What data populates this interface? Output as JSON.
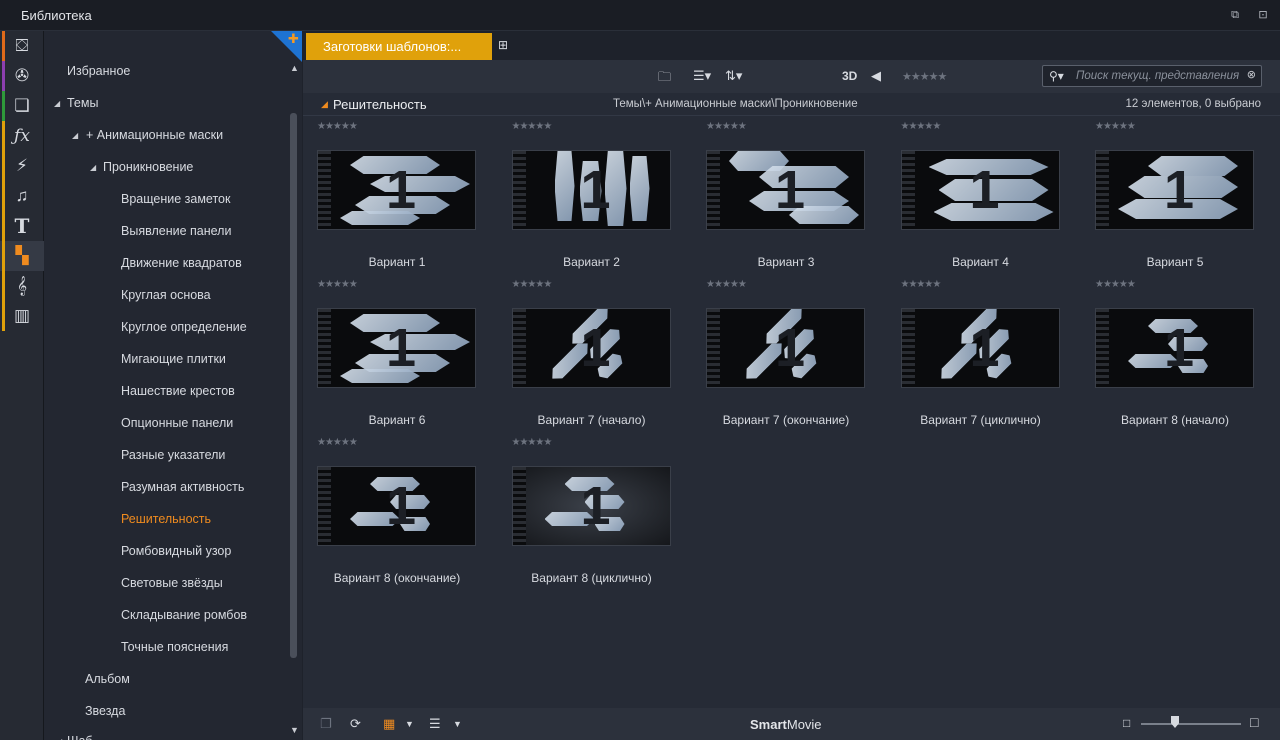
{
  "window": {
    "title": "Библиотека"
  },
  "sidebar_icons": [
    {
      "icon": "projects-icon",
      "stripe": "#e06a1a"
    },
    {
      "icon": "film-reel-icon",
      "stripe": "#8d3fb0"
    },
    {
      "icon": "media-stack-icon",
      "stripe": "#2e9a3a"
    },
    {
      "icon": "effects-icon",
      "stripe": "#e0a10b"
    },
    {
      "icon": "lightning-icon",
      "stripe": "#e0a10b"
    },
    {
      "icon": "music-note-icon",
      "stripe": "#e0a10b"
    },
    {
      "icon": "title-icon",
      "stripe": "#e0a10b"
    },
    {
      "icon": "montage-icon",
      "stripe": "#e0a10b"
    },
    {
      "icon": "treble-clef-icon",
      "stripe": "#e0a10b"
    },
    {
      "icon": "piano-icon",
      "stripe": "#e0a10b"
    }
  ],
  "tree": {
    "items": [
      {
        "label": "Избранное"
      },
      {
        "label": "Темы"
      },
      {
        "label": "+ Анимационные маски"
      },
      {
        "label": "Проникновение"
      },
      {
        "label": "Вращение заметок"
      },
      {
        "label": "Выявление панели"
      },
      {
        "label": "Движение квадратов"
      },
      {
        "label": "Круглая основа"
      },
      {
        "label": "Круглое определение"
      },
      {
        "label": "Мигающие плитки"
      },
      {
        "label": "Нашествие крестов"
      },
      {
        "label": "Опционные панели"
      },
      {
        "label": "Разные указатели"
      },
      {
        "label": "Разумная активность"
      },
      {
        "label": "Решительность",
        "selected": true
      },
      {
        "label": "Ромбовидный узор"
      },
      {
        "label": "Световые звёзды"
      },
      {
        "label": "Складывание ромбов"
      },
      {
        "label": "Точные пояснения"
      },
      {
        "label": "Альбом"
      },
      {
        "label": "Звезда"
      },
      {
        "label": "Шаб..."
      }
    ]
  },
  "tab": {
    "label": "Заготовки шаблонов:..."
  },
  "toolbar": {
    "three_d": "3D",
    "rating": "★★★★★",
    "search_placeholder": "Поиск текущ. представления"
  },
  "pathbar": {
    "title": "Решительность",
    "path": "Темы\\+ Анимационные маски\\Проникновение",
    "count": "12 элементов, 0 выбрано"
  },
  "items": [
    {
      "label": "Вариант 1",
      "stars": "★★★★★",
      "num": "1"
    },
    {
      "label": "Вариант 2",
      "stars": "★★★★★",
      "num": "1"
    },
    {
      "label": "Вариант 3",
      "stars": "★★★★★",
      "num": "1"
    },
    {
      "label": "Вариант 4",
      "stars": "★★★★★",
      "num": "1"
    },
    {
      "label": "Вариант 5",
      "stars": "★★★★★",
      "num": "1"
    },
    {
      "label": "Вариант 6",
      "stars": "★★★★★",
      "num": "1"
    },
    {
      "label": "Вариант 7 (начало)",
      "stars": "★★★★★",
      "num": "1"
    },
    {
      "label": "Вариант 7 (окончание)",
      "stars": "★★★★★",
      "num": "1"
    },
    {
      "label": "Вариант 7 (циклично)",
      "stars": "★★★★★",
      "num": "1"
    },
    {
      "label": "Вариант 8 (начало)",
      "stars": "★★★★★",
      "num": "1"
    },
    {
      "label": "Вариант 8 (окончание)",
      "stars": "★★★★★",
      "num": "1"
    },
    {
      "label": "Вариант 8 (циклично)",
      "stars": "★★★★★",
      "num": "1"
    }
  ],
  "bottombar": {
    "brand_bold": "Smart",
    "brand_rest": "Movie"
  }
}
